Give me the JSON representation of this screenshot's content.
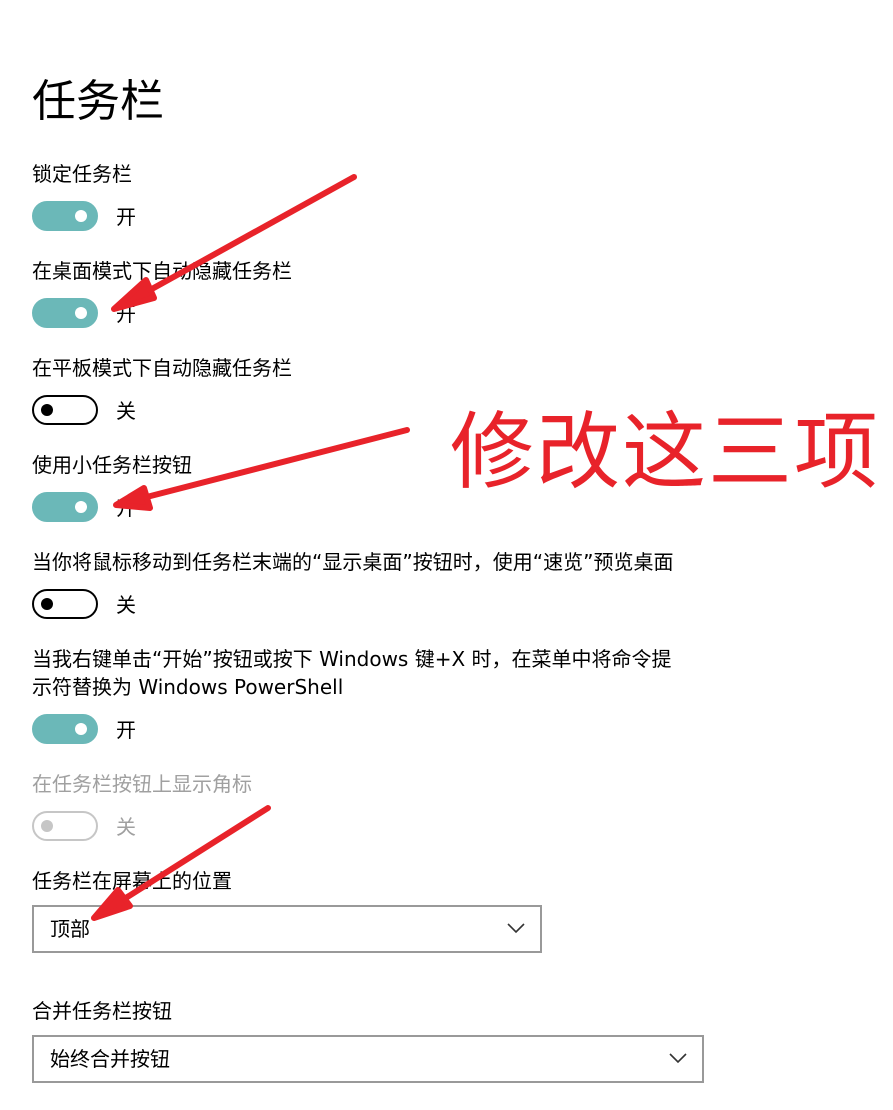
{
  "page": {
    "title": "任务栏"
  },
  "settings": [
    {
      "label": "锁定任务栏",
      "state": "on",
      "state_label": "开"
    },
    {
      "label": "在桌面模式下自动隐藏任务栏",
      "state": "on",
      "state_label": "开"
    },
    {
      "label": "在平板模式下自动隐藏任务栏",
      "state": "off",
      "state_label": "关"
    },
    {
      "label": "使用小任务栏按钮",
      "state": "on",
      "state_label": "开"
    },
    {
      "label": "当你将鼠标移动到任务栏末端的“显示桌面”按钮时，使用“速览”预览桌面",
      "state": "off",
      "state_label": "关"
    },
    {
      "label_line1": "当我右键单击“开始”按钮或按下 Windows 键+X 时，在菜单中将命令提",
      "label_line2": "示符替换为 Windows PowerShell",
      "state": "on",
      "state_label": "开"
    },
    {
      "label": "在任务栏按钮上显示角标",
      "state": "off",
      "state_label": "关",
      "disabled": true
    }
  ],
  "position_setting": {
    "label": "任务栏在屏幕上的位置",
    "selected": "顶部"
  },
  "combine_setting": {
    "label": "合并任务栏按钮",
    "selected": "始终合并按钮"
  },
  "annotation": {
    "text": "修改这三项",
    "color": "#e8232a"
  },
  "colors": {
    "toggle_on": "#6bb8b8",
    "toggle_off_border": "#000000",
    "disabled": "#c6c6c6"
  },
  "icons": {
    "dropdown": "chevron-down-icon",
    "annotation_arrow": "red-arrow-icon"
  }
}
